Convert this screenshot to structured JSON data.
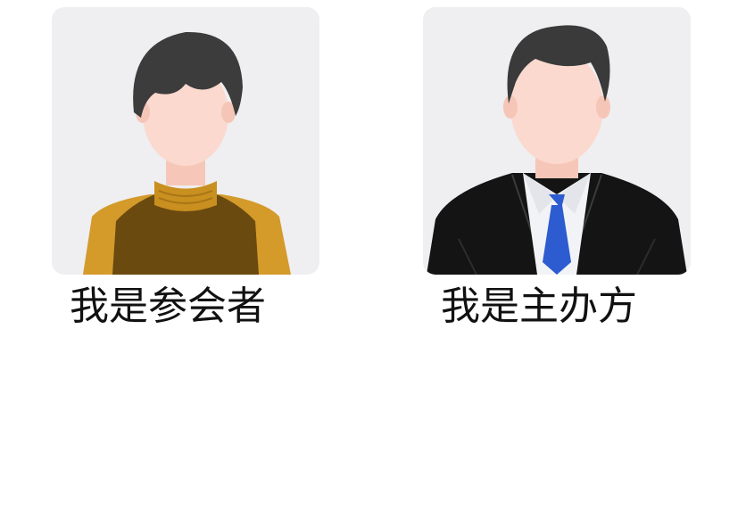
{
  "roles": [
    {
      "id": "attendee",
      "label": "我是参会者",
      "avatar_icon": "young-man-avatar-icon",
      "colors": {
        "shirt": "#6b4a10",
        "sleeve": "#d49a2a",
        "collar": "#c98f1f",
        "hair": "#3c3c3c",
        "skin": "#fbd9cf"
      }
    },
    {
      "id": "organizer",
      "label": "我是主办方",
      "avatar_icon": "businessman-avatar-icon",
      "colors": {
        "suit": "#141414",
        "shirt": "#f2f3f6",
        "tie": "#2d5bd0",
        "hair": "#3a3a3a",
        "skin": "#fbd9cf"
      }
    }
  ],
  "colors": {
    "card_background": "#efeef1",
    "label_text": "#111111",
    "page_background": "#ffffff"
  }
}
